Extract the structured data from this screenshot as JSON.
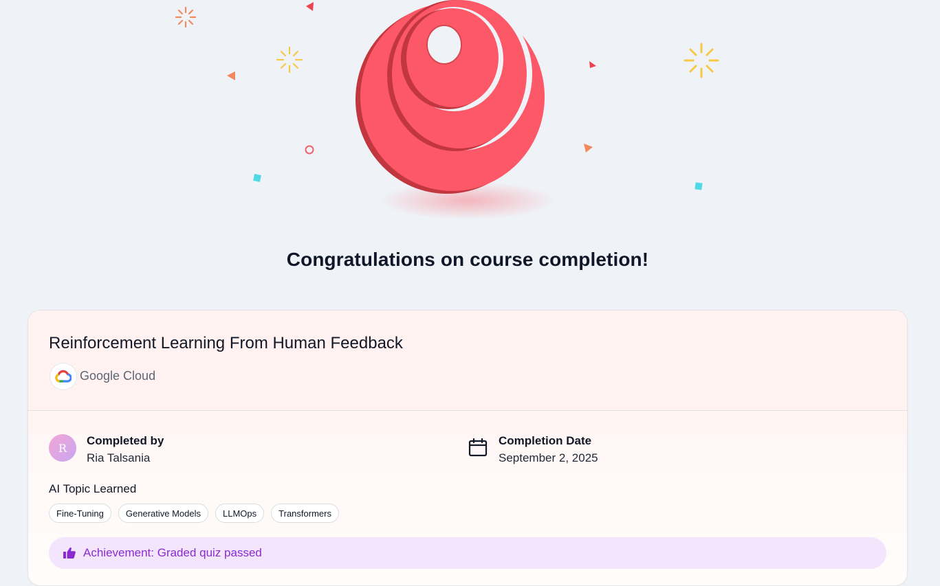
{
  "heading": "Congratulations on course completion!",
  "course": {
    "title": "Reinforcement Learning From Human Feedback",
    "provider": "Google Cloud",
    "provider_logo_icon": "google-cloud-logo"
  },
  "completed_by": {
    "label": "Completed by",
    "name": "Ria Talsania",
    "avatar_initial": "R"
  },
  "completion_date": {
    "label": "Completion Date",
    "value": "September 2, 2025",
    "icon": "calendar-icon"
  },
  "topics": {
    "label": "AI Topic Learned",
    "items": [
      "Fine-Tuning",
      "Generative Models",
      "LLMOps",
      "Transformers"
    ]
  },
  "achievement": {
    "text": "Achievement: Graded quiz passed",
    "icon": "thumbs-up-icon"
  },
  "colors": {
    "badge": "#fb5a66",
    "accent_purple": "#8a2bd0",
    "achievement_bg": "#f3e6fc",
    "background": "#eff3f8"
  }
}
